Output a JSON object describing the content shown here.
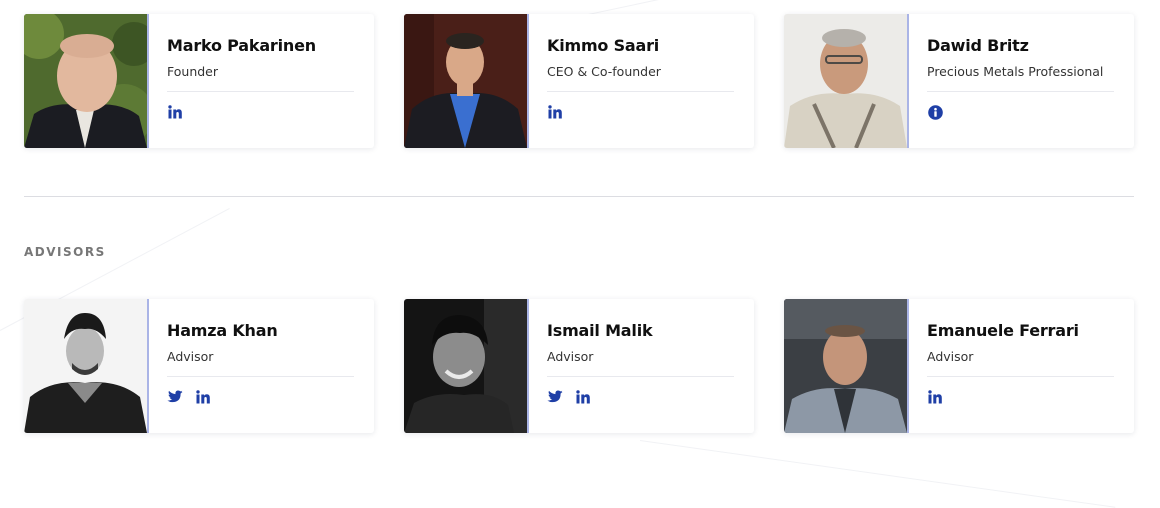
{
  "team": {
    "members": [
      {
        "name": "Marko Pakarinen",
        "role": "Founder",
        "socials": [
          "linkedin"
        ]
      },
      {
        "name": "Kimmo Saari",
        "role": "CEO & Co-founder",
        "socials": [
          "linkedin"
        ]
      },
      {
        "name": "Dawid Britz",
        "role": "Precious Metals Professional",
        "socials": [
          "info"
        ]
      }
    ]
  },
  "advisors": {
    "label": "ADVISORS",
    "members": [
      {
        "name": "Hamza Khan",
        "role": "Advisor",
        "socials": [
          "twitter",
          "linkedin"
        ]
      },
      {
        "name": "Ismail Malik",
        "role": "Advisor",
        "socials": [
          "twitter",
          "linkedin"
        ]
      },
      {
        "name": "Emanuele Ferrari",
        "role": "Advisor",
        "socials": [
          "linkedin"
        ]
      }
    ]
  },
  "colors": {
    "accent": "#1f3fa6",
    "photo_border": "#aab4e6"
  }
}
